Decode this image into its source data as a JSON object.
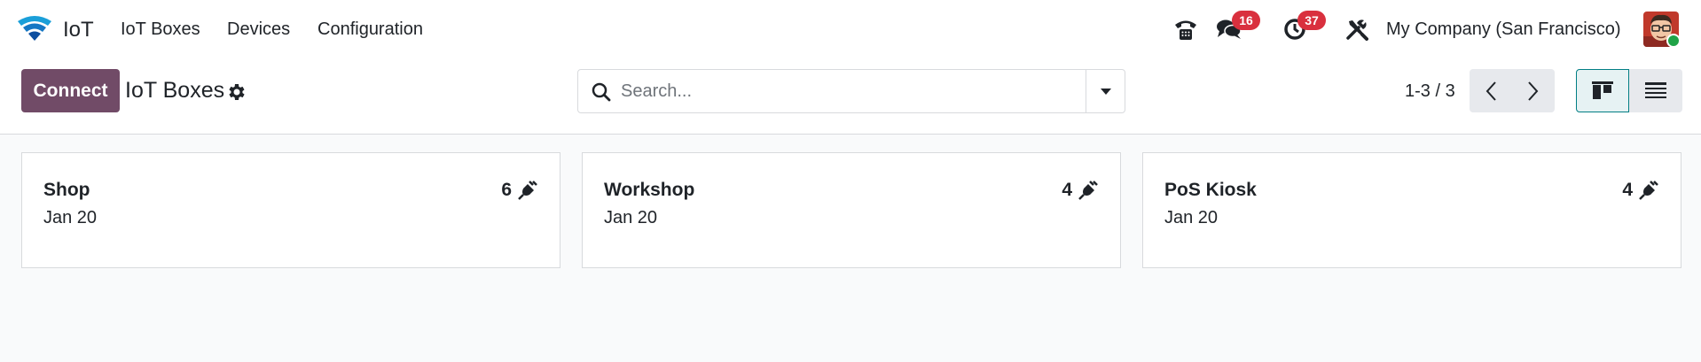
{
  "navbar": {
    "app_name": "IoT",
    "menu": [
      "IoT Boxes",
      "Devices",
      "Configuration"
    ],
    "messages_count": "16",
    "activities_count": "37",
    "company": "My Company (San Francisco)",
    "icons": [
      "phone-icon",
      "messages-icon",
      "activities-icon",
      "debug-tools-icon"
    ]
  },
  "control_panel": {
    "connect_label": "Connect",
    "title": "IoT Boxes",
    "search_placeholder": "Search...",
    "pager": "1-3 / 3"
  },
  "cards": [
    {
      "name": "Shop",
      "date": "Jan 20",
      "device_count": "6"
    },
    {
      "name": "Workshop",
      "date": "Jan 20",
      "device_count": "4"
    },
    {
      "name": "PoS Kiosk",
      "date": "Jan 20",
      "device_count": "4"
    }
  ],
  "colors": {
    "primary": "#714b67",
    "badge": "#d9303e",
    "accent": "#017e84",
    "background": "#f9fafb",
    "online": "#1fa347"
  }
}
